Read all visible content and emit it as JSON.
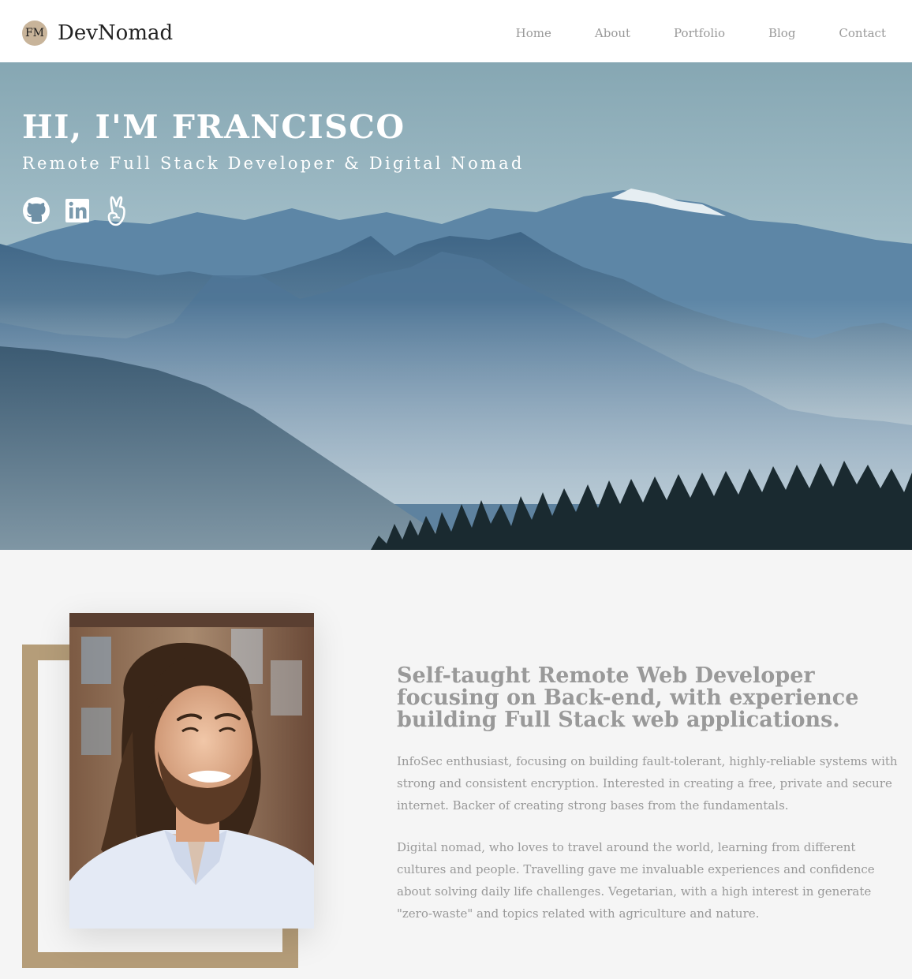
{
  "brand": {
    "badge": "FM",
    "name": "DevNomad"
  },
  "nav": {
    "items": [
      "Home",
      "About",
      "Portfolio",
      "Blog",
      "Contact"
    ]
  },
  "hero": {
    "title": "HI, I'M FRANCISCO",
    "subtitle": "Remote Full Stack Developer & Digital Nomad",
    "socials": [
      "github-icon",
      "linkedin-icon",
      "angellist-icon"
    ]
  },
  "about": {
    "lead": "Self-taught Remote Web Developer focusing on Back-end, with experience building Full Stack web applications.",
    "paragraphs": [
      "InfoSec enthusiast, focusing on building fault-tolerant, highly-reliable systems with strong and consistent encryption. Interested in creating a free, private and secure internet. Backer of creating strong bases from the fundamentals.",
      "Digital nomad, who loves to travel around the world, learning from different cultures and people. Travelling gave me invaluable experiences and confidence about solving daily life challenges. Vegetarian, with a high interest in generate \"zero-waste\" and topics related with agriculture and nature."
    ]
  },
  "colors": {
    "accent": "#b59d79",
    "logo_badge": "#c8b49a",
    "muted_text": "#999999",
    "background": "#f5f5f5"
  }
}
